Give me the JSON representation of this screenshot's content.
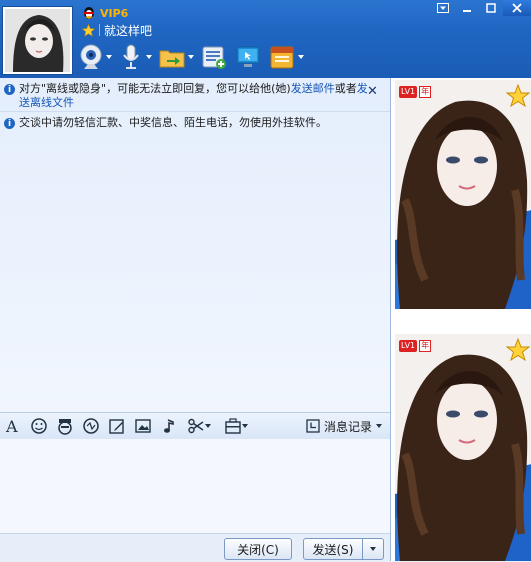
{
  "profile": {
    "vip_label": "VIP6",
    "signature": "就这样吧"
  },
  "window": {
    "menu_icon": "dropdown-menu-icon",
    "min_icon": "minimize-icon",
    "max_icon": "maximize-icon",
    "close_icon": "close-icon"
  },
  "toolbar": {
    "items": [
      "video-call-icon",
      "voice-call-icon",
      "file-transfer-icon",
      "contact-card-icon",
      "remote-assist-icon",
      "app-box-icon"
    ]
  },
  "notices": [
    {
      "prefix": "对方\"离线或隐身\"，可能无法立即回复，您可以给他(她)",
      "link1": "发送邮件",
      "mid": "或者",
      "link2": "发送离线文件"
    },
    {
      "text": "交谈中请勿轻信汇款、中奖信息、陌生电话，勿使用外挂软件。"
    }
  ],
  "format_bar": {
    "history_label": "消息记录"
  },
  "buttons": {
    "close": "关闭(C)",
    "send": "发送(S)"
  },
  "badges": {
    "level": "LV1",
    "year": "年",
    "level_right": "LV"
  },
  "colors": {
    "header": "#1f66c2",
    "link": "#1355b5",
    "vip": "#ffb400"
  }
}
